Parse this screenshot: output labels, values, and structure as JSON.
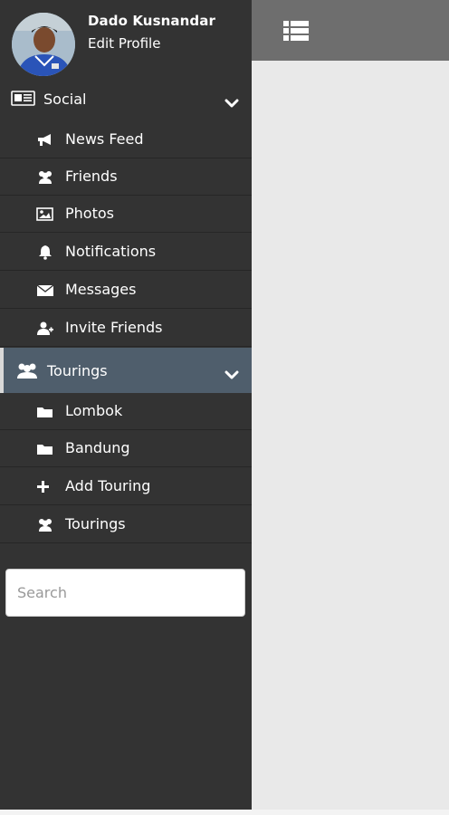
{
  "profile": {
    "name": "Dado Kusnandar",
    "edit_label": "Edit Profile"
  },
  "topbar": {
    "menu_icon": "list-icon"
  },
  "sections": {
    "social": {
      "label": "Social",
      "icon": "newspaper-icon",
      "items": [
        {
          "label": "News Feed",
          "icon": "bullhorn-icon"
        },
        {
          "label": "Friends",
          "icon": "users-icon"
        },
        {
          "label": "Photos",
          "icon": "image-icon"
        },
        {
          "label": "Notifications",
          "icon": "bell-icon"
        },
        {
          "label": "Messages",
          "icon": "envelope-icon"
        },
        {
          "label": "Invite Friends",
          "icon": "user-plus-icon"
        }
      ]
    },
    "tourings": {
      "label": "Tourings",
      "icon": "users-icon",
      "items": [
        {
          "label": "Lombok",
          "icon": "folder-icon"
        },
        {
          "label": "Bandung",
          "icon": "folder-icon"
        },
        {
          "label": "Add Touring",
          "icon": "plus-icon"
        },
        {
          "label": "Tourings",
          "icon": "users-icon"
        }
      ]
    }
  },
  "search": {
    "placeholder": "Search"
  },
  "colors": {
    "sidebar_bg": "#333333",
    "active_section_bg": "#4f5e6c",
    "topbar_bg": "#6e6e6e",
    "content_bg": "#e9e9e9"
  }
}
